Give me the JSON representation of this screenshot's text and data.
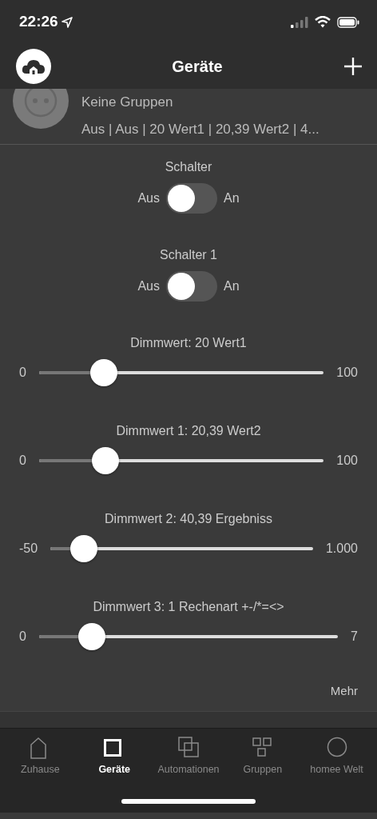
{
  "status_bar": {
    "time": "22:26"
  },
  "nav": {
    "title": "Geräte"
  },
  "device": {
    "group": "Keine Gruppen",
    "summary": "Aus | Aus | 20 Wert1 | 20,39 Wert2 | 4..."
  },
  "controls": [
    {
      "kind": "switch",
      "label": "Schalter",
      "off_label": "Aus",
      "on_label": "An",
      "on": false
    },
    {
      "kind": "switch",
      "label": "Schalter 1",
      "off_label": "Aus",
      "on_label": "An",
      "on": false
    },
    {
      "kind": "slider",
      "label": "Dimmwert: 20 Wert1",
      "min": "0",
      "max": "100",
      "level": 0.2
    },
    {
      "kind": "slider",
      "label": "Dimmwert 1: 20,39 Wert2",
      "min": "0",
      "max": "100",
      "level": 0.204
    },
    {
      "kind": "slider",
      "label": "Dimmwert 2: 40,39 Ergebniss",
      "min": "-50",
      "max": "1.000",
      "level": 0.086
    },
    {
      "kind": "slider",
      "label": "Dimmwert 3: 1 Rechenart +-/*=<>",
      "min": "0",
      "max": "7",
      "level": 0.143
    }
  ],
  "more": "Mehr",
  "tab_bar": [
    {
      "label": "Zuhause",
      "selected": false
    },
    {
      "label": "Geräte",
      "selected": true
    },
    {
      "label": "Automationen",
      "selected": false
    },
    {
      "label": "Gruppen",
      "selected": false
    },
    {
      "label": "homee Welt",
      "selected": false
    }
  ]
}
